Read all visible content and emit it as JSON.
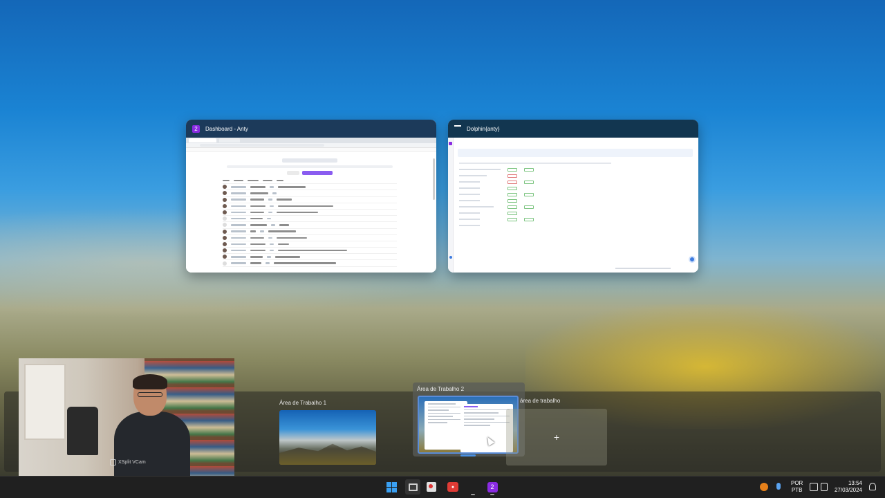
{
  "windows": [
    {
      "title": "Dashboard - Anty",
      "icon": "anty-app-icon",
      "icon_text": "2"
    },
    {
      "title": "Dolphin{anty}",
      "icon": "dolphin-app-icon"
    }
  ],
  "desktops": {
    "desktop1_label": "Área de Trabalho 1",
    "desktop2_label": "Área de Trabalho 2",
    "new_desktop_label": "área de trabalho",
    "new_desktop_plus": "+"
  },
  "webcam": {
    "watermark": "XSplit VCam"
  },
  "taskbar": {
    "items": [
      "start-icon",
      "task-view-icon",
      "snipping-tool-icon",
      "recorder-icon",
      "anty-icon"
    ],
    "anty_icon_text": "2",
    "recorder_text": "●"
  },
  "tray": {
    "lang_top": "POR",
    "lang_bottom": "PTB",
    "time": "13:54",
    "date": "27/03/2024"
  },
  "colors": {
    "accent": "#3aa0f3",
    "anty_purple": "#8a2be2",
    "taskbar": "#202020"
  }
}
